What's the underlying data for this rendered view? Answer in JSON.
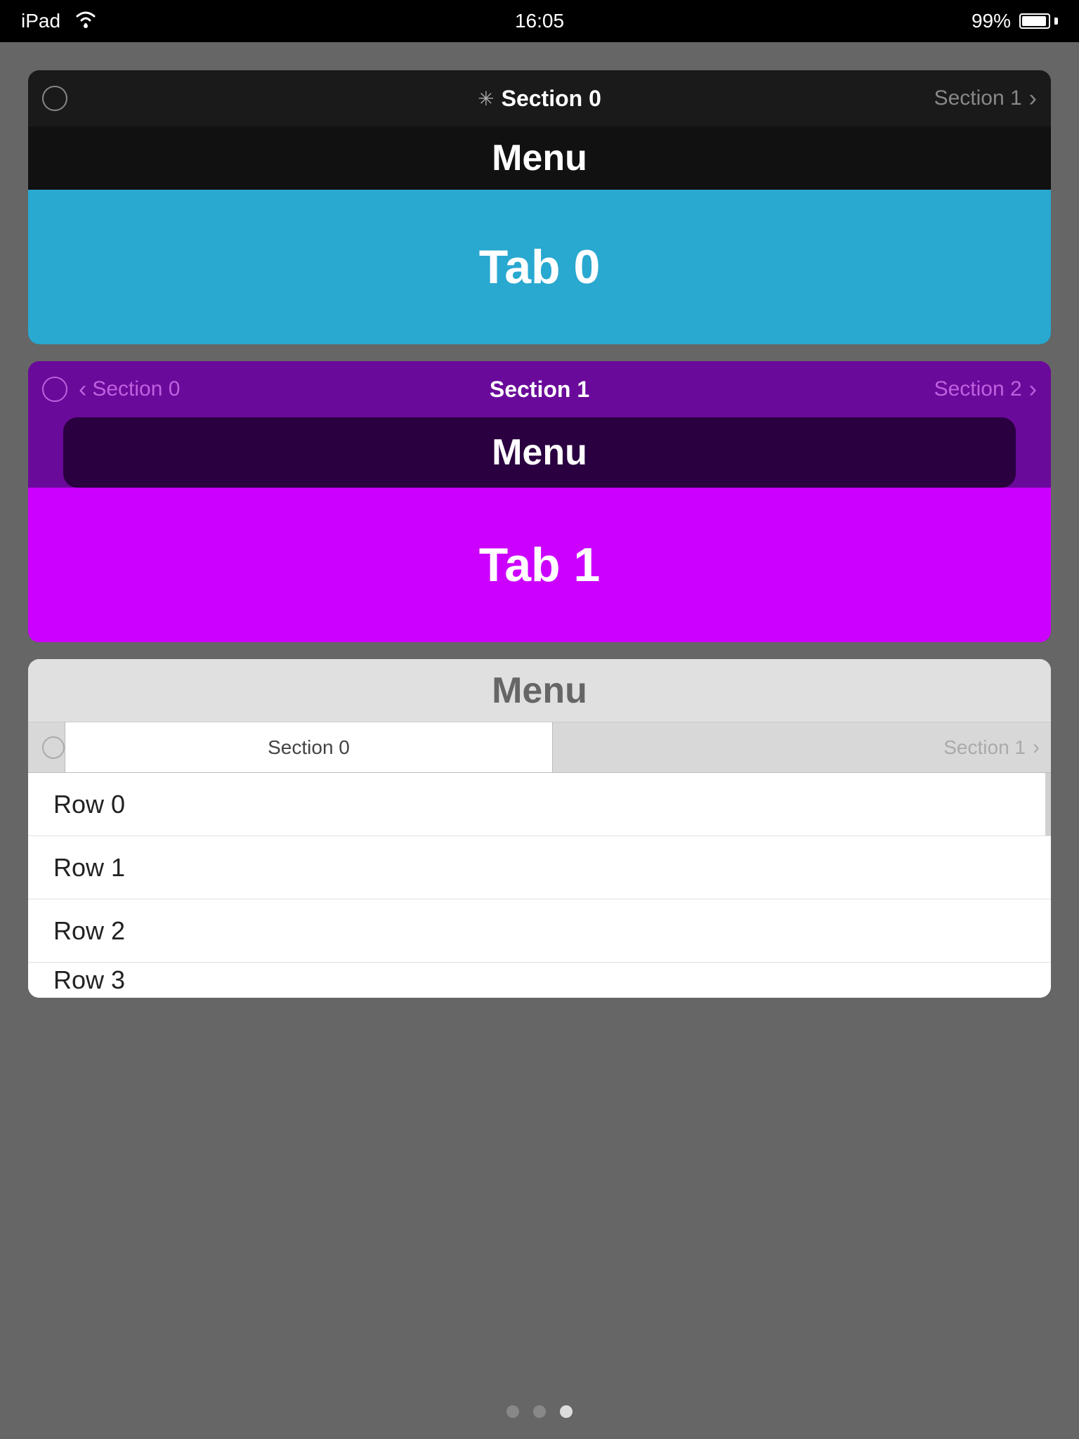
{
  "statusBar": {
    "carrier": "iPad",
    "time": "16:05",
    "battery": "99%"
  },
  "widget1": {
    "segBar": {
      "activeSection": "Section 0",
      "nextSection": "Section 1"
    },
    "menuTitle": "Menu",
    "tabTitle": "Tab 0",
    "tabColor": "#29a8d0"
  },
  "widget2": {
    "segBar": {
      "prevSection": "Section 0",
      "activeSection": "Section 1",
      "nextSection": "Section 2"
    },
    "menuTitle": "Menu",
    "tabTitle": "Tab 1",
    "tabColor": "#cc00ff"
  },
  "widget3": {
    "menuTitle": "Menu",
    "segBar": {
      "section0Label": "Section 0",
      "section1Label": "Section 1"
    },
    "rows": [
      "Row 0",
      "Row 1",
      "Row 2",
      "Row 3"
    ]
  },
  "pageDots": {
    "total": 3,
    "activeIndex": 2
  }
}
